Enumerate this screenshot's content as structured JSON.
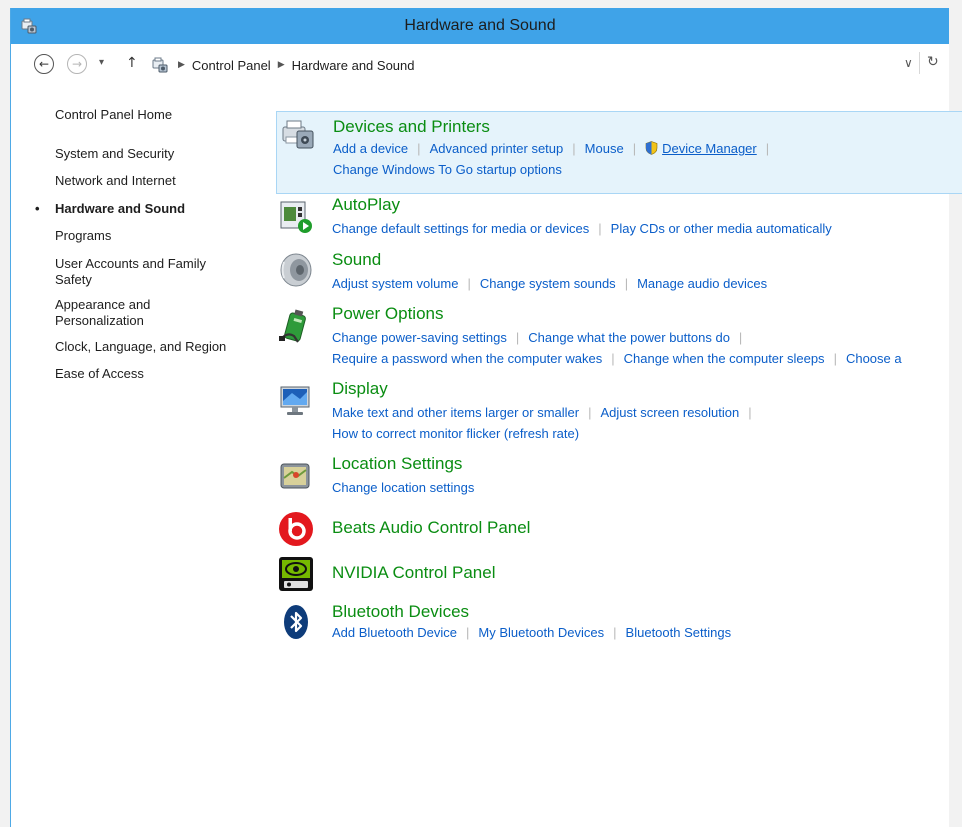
{
  "window": {
    "title": "Hardware and Sound"
  },
  "address": {
    "crumbs": [
      "Control Panel",
      "Hardware and Sound"
    ],
    "back_glyph": "←",
    "forward_glyph": "→",
    "dropdown_glyph": "▾",
    "up_glyph": "↑",
    "history_glyph": "∨",
    "refresh_glyph": "↻"
  },
  "sidebar": {
    "items": [
      {
        "label": "Control Panel Home"
      },
      {
        "label": "System and Security"
      },
      {
        "label": "Network and Internet"
      },
      {
        "label": "Hardware and Sound",
        "active": true,
        "bullet": "•"
      },
      {
        "label": "Programs"
      },
      {
        "label": "User Accounts and Family Safety"
      },
      {
        "label": "Appearance and Personalization"
      },
      {
        "label": "Clock, Language, and Region"
      },
      {
        "label": "Ease of Access"
      }
    ]
  },
  "categories": [
    {
      "title": "Devices and Printers",
      "icon": "printer-icon",
      "lines": [
        [
          "Add a device",
          "Advanced printer setup",
          "Mouse",
          "Device Manager"
        ],
        [
          "Change Windows To Go startup options"
        ]
      ]
    },
    {
      "title": "AutoPlay",
      "icon": "autoplay-icon",
      "lines": [
        [
          "Change default settings for media or devices",
          "Play CDs or other media automatically"
        ]
      ]
    },
    {
      "title": "Sound",
      "icon": "speaker-icon",
      "lines": [
        [
          "Adjust system volume",
          "Change system sounds",
          "Manage audio devices"
        ]
      ]
    },
    {
      "title": "Power Options",
      "icon": "battery-icon",
      "lines": [
        [
          "Change power-saving settings",
          "Change what the power buttons do"
        ],
        [
          "Require a password when the computer wakes",
          "Change when the computer sleeps",
          "Choose a"
        ]
      ]
    },
    {
      "title": "Display",
      "icon": "monitor-icon",
      "lines": [
        [
          "Make text and other items larger or smaller",
          "Adjust screen resolution"
        ],
        [
          "How to correct monitor flicker (refresh rate)"
        ]
      ]
    },
    {
      "title": "Location Settings",
      "icon": "location-icon",
      "lines": [
        [
          "Change location settings"
        ]
      ]
    },
    {
      "title": "Beats Audio Control Panel",
      "icon": "beats-icon",
      "lines": []
    },
    {
      "title": "NVIDIA Control Panel",
      "icon": "nvidia-icon",
      "lines": []
    },
    {
      "title": "Bluetooth Devices",
      "icon": "bluetooth-icon",
      "lines": [
        [
          "Add Bluetooth Device",
          "My Bluetooth Devices",
          "Bluetooth Settings"
        ]
      ]
    }
  ],
  "colors": {
    "titlebar": "#3fa3e8",
    "category_title": "#0a8d12",
    "link": "#0b5ec9",
    "selection_bg": "#e5f3fb"
  }
}
